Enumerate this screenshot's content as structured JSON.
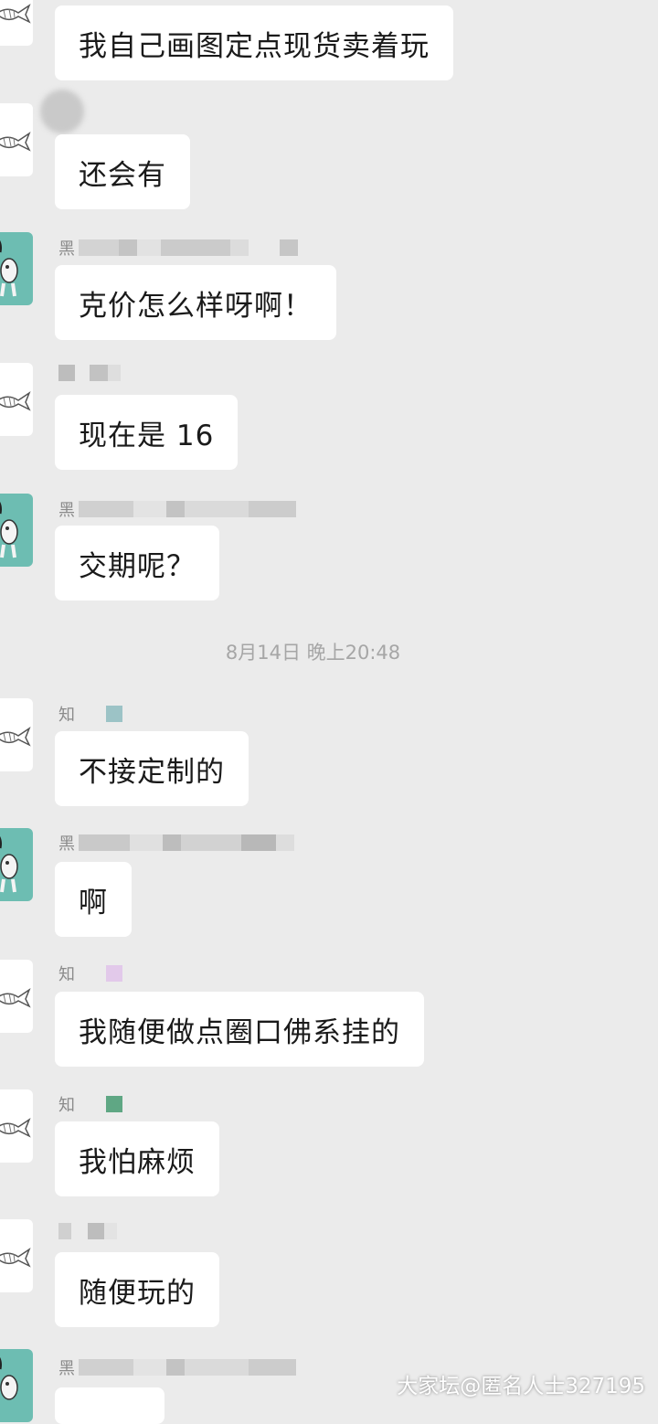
{
  "messages": [
    {
      "sender": "fish",
      "nick": "",
      "text": "我自己画图定点现货卖着玩"
    },
    {
      "sender": "fish",
      "nick": "",
      "text": "还会有"
    },
    {
      "sender": "cat",
      "nick": "黑",
      "text": "克价怎么样呀啊！"
    },
    {
      "sender": "fish",
      "nick": "",
      "text": "现在是 16"
    },
    {
      "sender": "cat",
      "nick": "黑",
      "text": "交期呢？"
    },
    {
      "sender": "fish",
      "nick": "知",
      "text": "不接定制的"
    },
    {
      "sender": "cat",
      "nick": "黑",
      "text": "啊"
    },
    {
      "sender": "fish",
      "nick": "知",
      "text": "我随便做点圈口佛系挂的"
    },
    {
      "sender": "fish",
      "nick": "知",
      "text": "我怕麻烦"
    },
    {
      "sender": "fish",
      "nick": "",
      "text": "随便玩的"
    },
    {
      "sender": "cat",
      "nick": "黑",
      "text": ""
    }
  ],
  "timestamp": "8月14日 晚上20:48",
  "watermark": "大家坛@匿名人士327195",
  "colors": {
    "background": "#ebebeb",
    "bubble": "#ffffff",
    "cat_avatar": "#6dbdb2",
    "timestamp_text": "#a6a6a6"
  },
  "icons": {
    "fish_avatar": "fish-sketch-icon",
    "cat_avatar": "cat-figure-icon"
  }
}
